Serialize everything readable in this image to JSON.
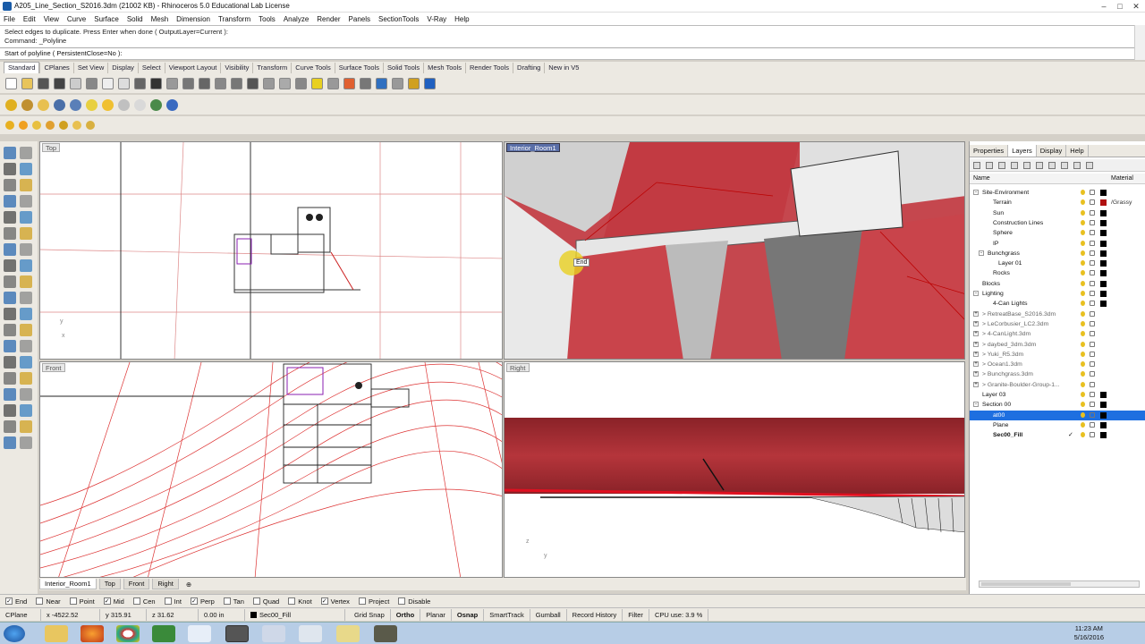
{
  "titlebar": {
    "title": "A205_Line_Section_S2016.3dm (21002 KB) - Rhinoceros 5.0 Educational Lab License"
  },
  "menubar": [
    "File",
    "Edit",
    "View",
    "Curve",
    "Surface",
    "Solid",
    "Mesh",
    "Dimension",
    "Transform",
    "Tools",
    "Analyze",
    "Render",
    "Panels",
    "SectionTools",
    "V-Ray",
    "Help"
  ],
  "command": {
    "history1": "Select edges to duplicate. Press Enter when done ( OutputLayer=Current ):",
    "history2": "Command: _Polyline",
    "prompt": "Start of polyline ( PersistentClose=No ):"
  },
  "toolbar_tabs": [
    "Standard",
    "CPlanes",
    "Set View",
    "Display",
    "Select",
    "Viewport Layout",
    "Visibility",
    "Transform",
    "Curve Tools",
    "Surface Tools",
    "Solid Tools",
    "Mesh Tools",
    "Render Tools",
    "Drafting",
    "New in V5"
  ],
  "viewports": {
    "top": "Top",
    "perspective": "Interior_Room1",
    "front": "Front",
    "right": "Right",
    "snap_marker": "End"
  },
  "panel": {
    "tabs": [
      "Properties",
      "Layers",
      "Display",
      "Help"
    ],
    "col_name": "Name",
    "col_material": "Material",
    "layers": [
      {
        "name": "Site-Environment",
        "indent": 0,
        "exp": "-",
        "color": "#000000"
      },
      {
        "name": "Terrain",
        "indent": 2,
        "exp": "",
        "color": "#b01010",
        "material": "/Grassy"
      },
      {
        "name": "Sun",
        "indent": 2,
        "exp": "",
        "color": "#000000"
      },
      {
        "name": "Construction Lines",
        "indent": 2,
        "exp": "",
        "color": "#000000"
      },
      {
        "name": "Sphere",
        "indent": 2,
        "exp": "",
        "color": "#000000"
      },
      {
        "name": "IP",
        "indent": 2,
        "exp": "",
        "color": "#000000"
      },
      {
        "name": "Bunchgrass",
        "indent": 1,
        "exp": "-",
        "color": "#000000"
      },
      {
        "name": "Layer 01",
        "indent": 3,
        "exp": "",
        "color": "#000000"
      },
      {
        "name": "Rocks",
        "indent": 2,
        "exp": "",
        "color": "#000000"
      },
      {
        "name": "Blocks",
        "indent": 0,
        "exp": "",
        "color": "#000000"
      },
      {
        "name": "Lighting",
        "indent": 0,
        "exp": "-",
        "color": "#000000"
      },
      {
        "name": "4-Can Lights",
        "indent": 2,
        "exp": "",
        "color": "#000000"
      },
      {
        "name": "> RetreatBase_S2016.3dm",
        "indent": 0,
        "exp": "+",
        "color": "",
        "ref": true
      },
      {
        "name": "> LeCorbusier_LC2.3dm",
        "indent": 0,
        "exp": "+",
        "color": "",
        "ref": true
      },
      {
        "name": "> 4-CanLight.3dm",
        "indent": 0,
        "exp": "+",
        "color": "",
        "ref": true
      },
      {
        "name": "> daybed_3dm.3dm",
        "indent": 0,
        "exp": "+",
        "color": "",
        "ref": true
      },
      {
        "name": "> Yuki_R5.3dm",
        "indent": 0,
        "exp": "+",
        "color": "",
        "ref": true
      },
      {
        "name": "> Ocean1.3dm",
        "indent": 0,
        "exp": "+",
        "color": "",
        "ref": true
      },
      {
        "name": "> Bunchgrass.3dm",
        "indent": 0,
        "exp": "+",
        "color": "",
        "ref": true
      },
      {
        "name": "> Granite-Boulder-Group-1...",
        "indent": 0,
        "exp": "+",
        "color": "",
        "ref": true
      },
      {
        "name": "Layer 03",
        "indent": 0,
        "exp": "",
        "color": "#000000"
      },
      {
        "name": "Section 00",
        "indent": 0,
        "exp": "-",
        "color": "#000000"
      },
      {
        "name": "at00",
        "indent": 2,
        "exp": "",
        "color": "#000000",
        "selected": true
      },
      {
        "name": "Plane",
        "indent": 2,
        "exp": "",
        "color": "#000000"
      },
      {
        "name": "Sec00_Fill",
        "indent": 2,
        "exp": "",
        "color": "#000000",
        "current": true
      }
    ]
  },
  "viewport_tabs": [
    "Interior_Room1",
    "Top",
    "Front",
    "Right"
  ],
  "osnaps": [
    {
      "label": "End",
      "checked": true
    },
    {
      "label": "Near",
      "checked": false
    },
    {
      "label": "Point",
      "checked": false
    },
    {
      "label": "Mid",
      "checked": true
    },
    {
      "label": "Cen",
      "checked": false
    },
    {
      "label": "Int",
      "checked": false
    },
    {
      "label": "Perp",
      "checked": true
    },
    {
      "label": "Tan",
      "checked": false
    },
    {
      "label": "Quad",
      "checked": false
    },
    {
      "label": "Knot",
      "checked": false
    },
    {
      "label": "Vertex",
      "checked": true
    },
    {
      "label": "Project",
      "checked": false
    },
    {
      "label": "Disable",
      "checked": false
    }
  ],
  "status": {
    "cplane": "CPlane",
    "x": "x -4522.52",
    "y": "y 315.91",
    "z": "z 31.62",
    "units": "0.00 in",
    "layer": "Sec00_Fill",
    "grid_snap": "Grid Snap",
    "ortho": "Ortho",
    "planar": "Planar",
    "osnap": "Osnap",
    "smarttrack": "SmartTrack",
    "gumball": "Gumball",
    "record_history": "Record History",
    "filter": "Filter",
    "cpu": "CPU use: 3.9 %"
  },
  "clock": {
    "time": "11:23 AM",
    "date": "5/16/2016"
  }
}
